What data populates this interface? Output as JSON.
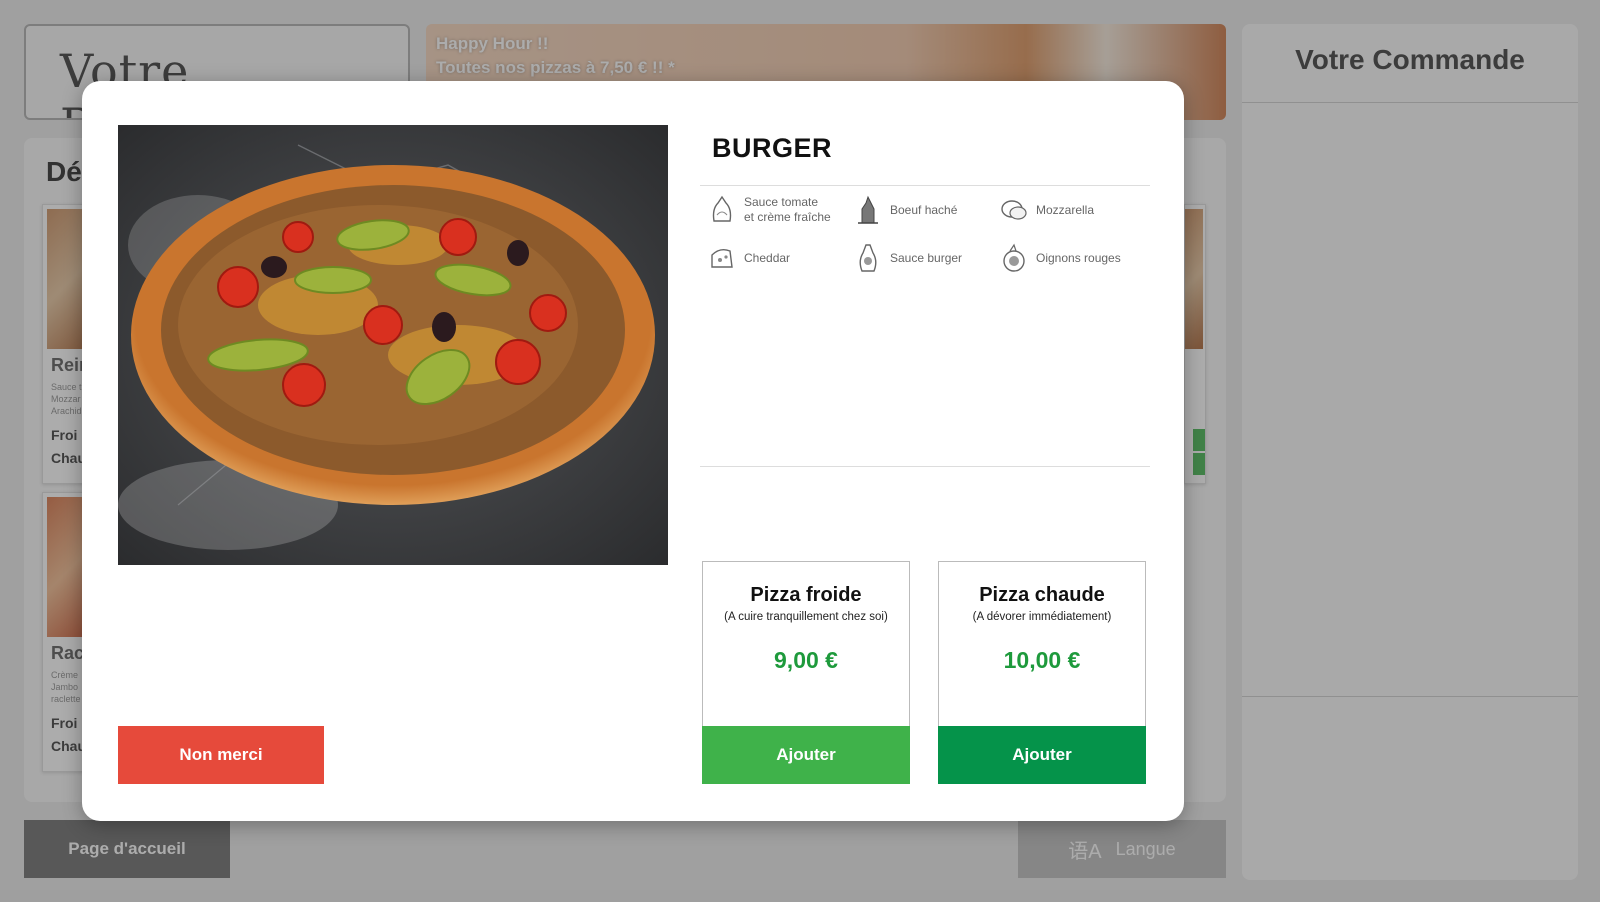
{
  "background": {
    "logo_text": "Votre PIZZERIA",
    "promo_line1": "Happy Hour !!",
    "promo_line2": "Toutes nos pizzas à 7,50 € !! *",
    "menu_heading": "Dé",
    "cards": [
      {
        "title": "Rein",
        "desc": "Sauce t\nMozzar\nArachid",
        "row1": "Froi",
        "row2": "Chau"
      },
      {
        "title": "Racl",
        "desc": "Crème\nJambo\nraclette",
        "row1": "Froi",
        "row2": "Chau"
      }
    ],
    "order_title": "Votre Commande",
    "home_button": "Page d'accueil",
    "lang_icon_glyph": "语A",
    "lang_button": "Langue"
  },
  "modal": {
    "title": "BURGER",
    "ingredients": [
      {
        "label": "Sauce tomate\net crème fraîche",
        "icon": "sauce-icon"
      },
      {
        "label": "Boeuf haché",
        "icon": "beef-icon"
      },
      {
        "label": "Mozzarella",
        "icon": "mozzarella-icon"
      },
      {
        "label": "Cheddar",
        "icon": "cheddar-icon"
      },
      {
        "label": "Sauce burger",
        "icon": "burger-sauce-icon"
      },
      {
        "label": "Oignons rouges",
        "icon": "onion-icon"
      }
    ],
    "options": [
      {
        "title": "Pizza froide",
        "subtitle": "(A cuire tranquillement chez soi)",
        "price": "9,00 €",
        "button": "Ajouter"
      },
      {
        "title": "Pizza chaude",
        "subtitle": "(A dévorer immédiatement)",
        "price": "10,00 €",
        "button": "Ajouter"
      }
    ],
    "decline_button": "Non merci"
  },
  "colors": {
    "decline": "#e64a3b",
    "add_cold": "#3fb24a",
    "add_hot": "#05934a",
    "price": "#1e9a3c"
  }
}
